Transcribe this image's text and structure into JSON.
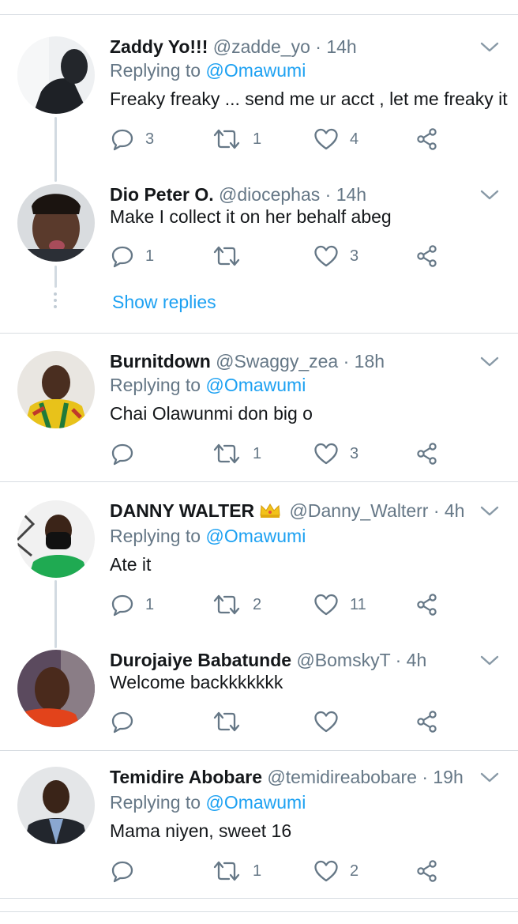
{
  "reply_prefix": "Replying to",
  "show_replies": "Show replies",
  "colors": {
    "accent": "#1da1f2",
    "secondary": "#657786",
    "text": "#14171a",
    "divider": "#d8dde2"
  },
  "tweets": [
    {
      "name": "Zaddy Yo!!!",
      "handle": "@zadde_yo",
      "time": "14h",
      "replying_to": "@Omawumi",
      "text": "Freaky freaky ... send me ur acct , let me freaky it",
      "replies": "3",
      "retweets": "1",
      "likes": "4"
    },
    {
      "name": "Dio Peter O.",
      "handle": "@diocephas",
      "time": "14h",
      "text": "Make I collect it on her behalf abeg",
      "replies": "1",
      "retweets": "",
      "likes": "3"
    },
    {
      "name": "Burnitdown",
      "handle": "@Swaggy_zea",
      "time": "18h",
      "replying_to": "@Omawumi",
      "text": "Chai Olawunmi don big o",
      "replies": "",
      "retweets": "1",
      "likes": "3"
    },
    {
      "name": "DANNY WALTER",
      "badge": "crown-icon",
      "handle": "@Danny_Walterr",
      "time": "4h",
      "replying_to": "@Omawumi",
      "text": "Ate it",
      "replies": "1",
      "retweets": "2",
      "likes": "11"
    },
    {
      "name": "Durojaiye Babatunde",
      "handle": "@BomskyT",
      "time": "4h",
      "text": "Welcome backkkkkkk",
      "replies": "",
      "retweets": "",
      "likes": ""
    },
    {
      "name": "Temidire Abobare",
      "handle": "@temidireabobare",
      "time": "19h",
      "replying_to": "@Omawumi",
      "text": "Mama niyen, sweet 16",
      "replies": "",
      "retweets": "1",
      "likes": "2"
    }
  ]
}
